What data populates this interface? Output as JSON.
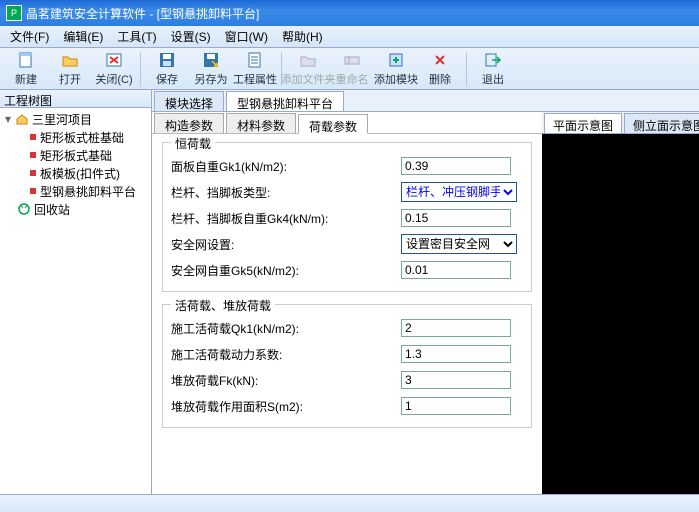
{
  "title": "晶茗建筑安全计算软件 - [型钢悬挑卸料平台]",
  "menus": [
    "文件(F)",
    "编辑(E)",
    "工具(T)",
    "设置(S)",
    "窗口(W)",
    "帮助(H)"
  ],
  "toolbar": [
    {
      "name": "new",
      "label": "新建",
      "disabled": false
    },
    {
      "name": "open",
      "label": "打开",
      "disabled": false
    },
    {
      "name": "close",
      "label": "关闭(C)",
      "disabled": false
    },
    {
      "sep": true
    },
    {
      "name": "save",
      "label": "保存",
      "disabled": false
    },
    {
      "name": "saveas",
      "label": "另存为",
      "disabled": false
    },
    {
      "name": "projprop",
      "label": "工程属性",
      "disabled": false
    },
    {
      "sep": true
    },
    {
      "name": "addfolder",
      "label": "添加文件夹",
      "disabled": true
    },
    {
      "name": "rename",
      "label": "重命名",
      "disabled": true
    },
    {
      "name": "addmodule",
      "label": "添加模块",
      "disabled": false
    },
    {
      "name": "delete",
      "label": "删除",
      "disabled": false
    },
    {
      "sep": true
    },
    {
      "name": "exit",
      "label": "退出",
      "disabled": false
    }
  ],
  "treeHeader": "工程树图",
  "tree": {
    "root": "三里河项目",
    "children": [
      "矩形板式桩基础",
      "矩形板式基础",
      "板模板(扣件式)",
      "型钢悬挑卸料平台"
    ],
    "recycle": "回收站"
  },
  "modTabs": {
    "a": "模块选择",
    "b": "型钢悬挑卸料平台"
  },
  "paramTabs": {
    "a": "构造参数",
    "b": "材料参数",
    "c": "荷载参数"
  },
  "group1": {
    "legend": "恒荷载",
    "r1": {
      "label": "面板自重Gk1(kN/m2):",
      "val": "0.39"
    },
    "r2": {
      "label": "栏杆、挡脚板类型:",
      "val": "栏杆、冲压钢脚手"
    },
    "r3": {
      "label": "栏杆、挡脚板自重Gk4(kN/m):",
      "val": "0.15"
    },
    "r4": {
      "label": "安全网设置:",
      "val": "设置密目安全网"
    },
    "r5": {
      "label": "安全网自重Gk5(kN/m2):",
      "val": "0.01"
    }
  },
  "group2": {
    "legend": "活荷载、堆放荷载",
    "r1": {
      "label": "施工活荷载Qk1(kN/m2):",
      "val": "2"
    },
    "r2": {
      "label": "施工活荷载动力系数:",
      "val": "1.3"
    },
    "r3": {
      "label": "堆放荷载Fk(kN):",
      "val": "3"
    },
    "r4": {
      "label": "堆放荷载作用面积S(m2):",
      "val": "1"
    }
  },
  "rightTabs": {
    "a": "平面示意图",
    "b": "侧立面示意图"
  }
}
